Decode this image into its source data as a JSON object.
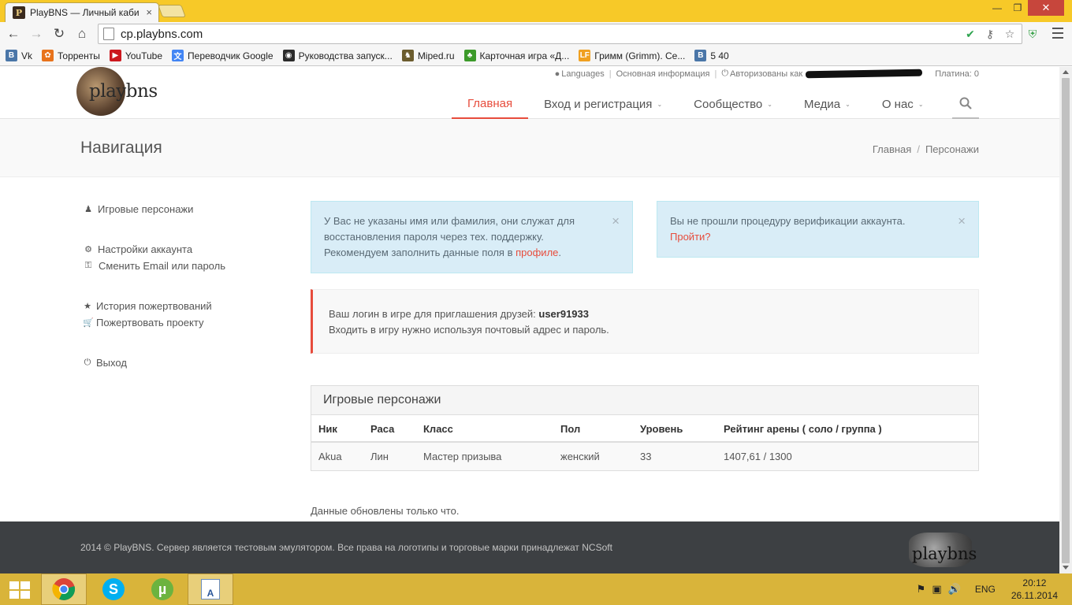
{
  "browser": {
    "tab_title": "PlayBNS — Личный каби",
    "tab_favicon": "P",
    "close_glyph": "×",
    "url": "cp.playbns.com",
    "bookmarks": [
      {
        "label": "Vk",
        "icon": "vk-icon",
        "icon_text": "B",
        "color": "#4a76a8"
      },
      {
        "label": "Торренты",
        "icon": "flower-icon",
        "icon_text": "✿",
        "color": "#e8731c"
      },
      {
        "label": "YouTube",
        "icon": "youtube-icon",
        "icon_text": "▶",
        "color": "#cc181e"
      },
      {
        "label": "Переводчик Google",
        "icon": "translate-icon",
        "icon_text": "文",
        "color": "#4285f4"
      },
      {
        "label": "Руководства запуск...",
        "icon": "guide-icon",
        "icon_text": "◉",
        "color": "#2b2b2b"
      },
      {
        "label": "Miped.ru",
        "icon": "miped-icon",
        "icon_text": "♞",
        "color": "#6b5c2e"
      },
      {
        "label": "Карточная игра «Д...",
        "icon": "cardgame-icon",
        "icon_text": "♣",
        "color": "#3c9a2a"
      },
      {
        "label": "Гримм (Grimm). Се...",
        "icon": "lf-icon",
        "icon_text": "LF",
        "color": "#f0a020"
      },
      {
        "label": "5 40",
        "icon": "vk-icon",
        "icon_text": "B",
        "color": "#4a76a8"
      }
    ]
  },
  "header": {
    "logo_text": "playbns",
    "top_links": {
      "languages": "Languages",
      "basic_info": "Основная информация",
      "authorized": "Авторизованы как",
      "platinum": "Платина: 0"
    },
    "nav": [
      {
        "label": "Главная",
        "caret": false
      },
      {
        "label": "Вход и регистрация",
        "caret": true
      },
      {
        "label": "Сообщество",
        "caret": true
      },
      {
        "label": "Медиа",
        "caret": true
      },
      {
        "label": "О нас",
        "caret": true
      }
    ],
    "caret_glyph": "⌄"
  },
  "breadcrumbs": {
    "title": "Навигация",
    "items": [
      "Главная",
      "Персонажи"
    ],
    "separator": "/"
  },
  "sidebar": {
    "characters": "Игровые персонажи",
    "account_settings": "Настройки аккаунта",
    "change_email_password": "Сменить Email или пароль",
    "donation_history": "История пожертвований",
    "donate": "Пожертвовать проекту",
    "logout": "Выход"
  },
  "alerts": {
    "name_missing": {
      "text": "У Вас не указаны имя или фамилия, они служат для восстановления пароля через тех. поддержку. Рекомендуем заполнить данные поля в ",
      "link": "профиле",
      "end": "."
    },
    "verification": {
      "text": "Вы не прошли процедуру верификации аккаунта.",
      "link": "Пройти?"
    }
  },
  "login_info": {
    "prefix": "Ваш логин в игре для приглашения друзей: ",
    "login": "user91933",
    "note": "Входить в игру нужно используя почтовый адрес и пароль."
  },
  "characters_table": {
    "title": "Игровые персонажи",
    "columns": [
      "Ник",
      "Раса",
      "Класс",
      "Пол",
      "Уровень",
      "Рейтинг арены ( соло / группа )"
    ],
    "rows": [
      [
        "Akua",
        "Лин",
        "Мастер призыва",
        "женский",
        "33",
        "1407,61 / 1300"
      ]
    ]
  },
  "updated_text": "Данные обновлены только что.",
  "footer": {
    "text": "2014 © PlayBNS. Сервер является тестовым эмулятором. Все права на логотипы и торговые марки принадлежат NCSoft",
    "logo_text": "playbns"
  },
  "taskbar": {
    "language": "ENG",
    "time": "20:12",
    "date": "26.11.2014"
  },
  "colors": {
    "accent": "#e74c3c",
    "titlebar": "#f7c928",
    "taskbar": "#d9b43a",
    "footer": "#3d4043",
    "alert_info_bg": "#d9edf7"
  }
}
